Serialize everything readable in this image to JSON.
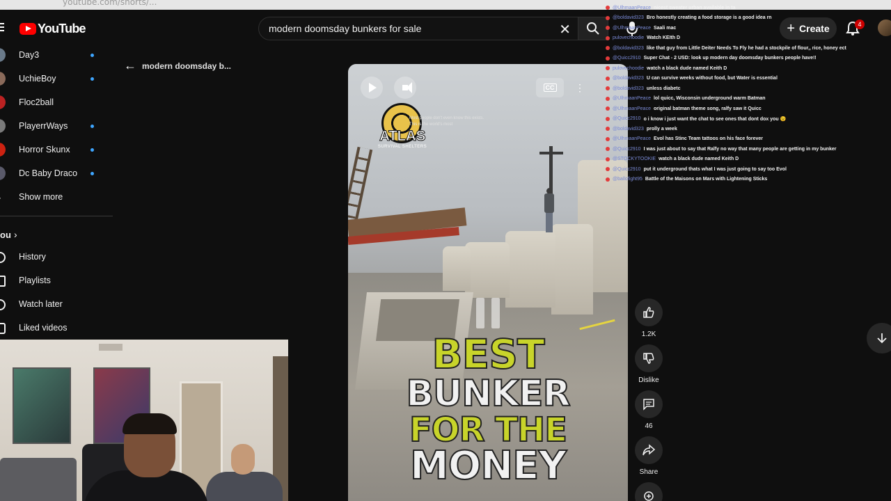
{
  "browser": {
    "url": "youtube.com/shorts/..."
  },
  "header": {
    "logo_text": "YouTube",
    "search_value": "modern doomsday bunkers for sale",
    "create_label": "Create",
    "notification_count": "4"
  },
  "sidebar": {
    "subscriptions": [
      {
        "label": "Day3"
      },
      {
        "label": "UchieBoy"
      },
      {
        "label": "Floc2ball"
      },
      {
        "label": "PlayerrWays"
      },
      {
        "label": "Horror Skunx"
      },
      {
        "label": "Dc Baby Draco"
      }
    ],
    "show_more": "Show more",
    "you_label": "ou",
    "nav": [
      {
        "label": "History"
      },
      {
        "label": "Playlists"
      },
      {
        "label": "Watch later"
      },
      {
        "label": "Liked videos"
      }
    ]
  },
  "page": {
    "back_title": "modern doomsday b..."
  },
  "video": {
    "brand_name": "ATLAS",
    "brand_sub": "SURVIVAL SHELTERS",
    "caption_line1": "Most people don't even know this exists.",
    "caption_line2": "This is the world's most",
    "cc_label": "CC",
    "headline_1": "BEST",
    "headline_2": "BUNKER",
    "headline_3": "FOR THE",
    "headline_4": "MONEY"
  },
  "actions": {
    "like_count": "1.2K",
    "dislike_label": "Dislike",
    "comment_count": "46",
    "share_label": "Share"
  },
  "chat": [
    {
      "user": "@UlhmaanPeace",
      "msg": "nicest sweater urban available in ta"
    },
    {
      "user": "@boldavid323",
      "msg": "Bro honestly creating a food storage is a good idea rn"
    },
    {
      "user": "@UlhmaanPeace",
      "msg": "Saali mac"
    },
    {
      "user": "pulovechoodie",
      "msg": "Watch KEIth D"
    },
    {
      "user": "@boldavid323",
      "msg": "like that guy from Little Deiter Needs To Fly he had a stockpile of flour,, rice, honey ect"
    },
    {
      "user": "@Quicc2910",
      "msg": "Super Chat - 2 USD: look up modern day doomsday bunkers people have!!"
    },
    {
      "user": "pulovechoodie",
      "msg": "watch a black dude named Keith D"
    },
    {
      "user": "@boldavid323",
      "msg": "U can survive weeks without food, but Water is essential"
    },
    {
      "user": "@boldavid323",
      "msg": "unless diabetc"
    },
    {
      "user": "@UlhmaanPeace",
      "msg": "lol quicc, Wisconsin underground warm Batman"
    },
    {
      "user": "@UlhmaanPeace",
      "msg": "original batman theme song, ralfy saw it Quicc"
    },
    {
      "user": "@Quicc2910",
      "msg": "o i know i just want the chat to see ones that dont dox you 😉"
    },
    {
      "user": "@boldavid323",
      "msg": "prolly a week"
    },
    {
      "user": "@UlhmaanPeace",
      "msg": "Evol has Stinc Team tattoos on his face forever"
    },
    {
      "user": "@Quicc2910",
      "msg": "I was just about to say that Ralfy no way that many people are getting in my bunker"
    },
    {
      "user": "@STOCKYTOOKIE",
      "msg": "watch a black dude named Keith D"
    },
    {
      "user": "@Quicc2910",
      "msg": "put it underground thats what I was just going to say too Evol"
    },
    {
      "user": "@ballofight95",
      "msg": "Battle of the Maisons on Mars with Lightening Sticks"
    }
  ],
  "colors": {
    "background": "#0f0f0f",
    "brand_red": "#ff0000",
    "subscription_dot": "#3ea6ff",
    "headline_yellow": "#c8d42a",
    "chat_username": "#7a8ad6"
  },
  "icons": {
    "menu": "hamburger-icon",
    "search": "search-icon",
    "clear": "close-icon",
    "mic": "mic-icon",
    "create": "plus-icon",
    "notifications": "bell-icon",
    "back": "arrow-left-icon",
    "like": "thumbs-up-icon",
    "dislike": "thumbs-down-icon",
    "comments": "comment-icon",
    "share": "share-icon",
    "remix": "remix-icon",
    "next": "arrow-down-icon"
  }
}
